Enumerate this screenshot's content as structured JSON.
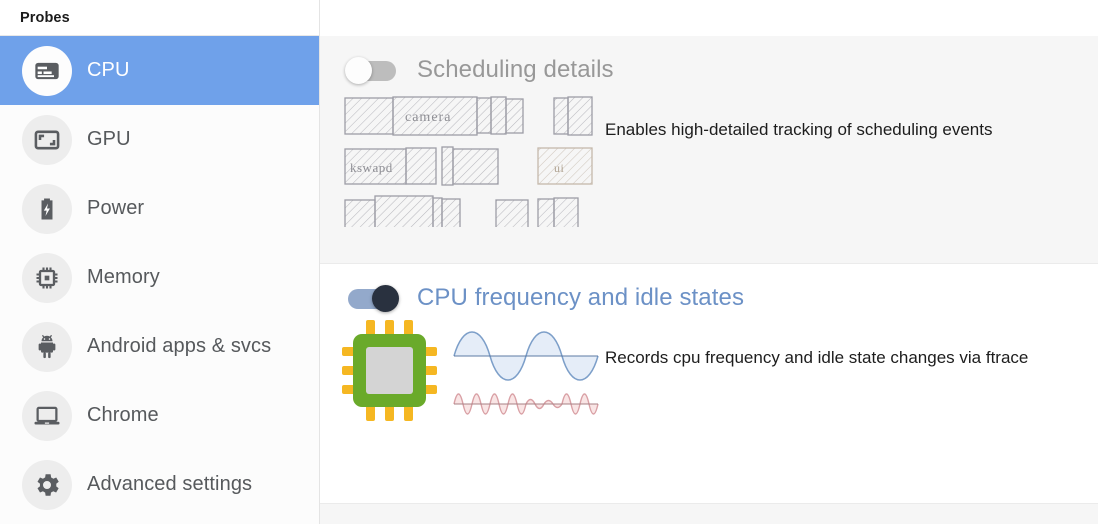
{
  "sidebar": {
    "title": "Probes",
    "items": [
      {
        "label": "CPU",
        "icon": "cpu-card-icon",
        "active": true
      },
      {
        "label": "GPU",
        "icon": "gpu-screen-icon",
        "active": false
      },
      {
        "label": "Power",
        "icon": "battery-bolt-icon",
        "active": false
      },
      {
        "label": "Memory",
        "icon": "memory-chip-icon",
        "active": false
      },
      {
        "label": "Android apps & svcs",
        "icon": "android-robot-icon",
        "active": false
      },
      {
        "label": "Chrome",
        "icon": "laptop-icon",
        "active": false
      },
      {
        "label": "Advanced settings",
        "icon": "gear-icon",
        "active": false
      }
    ]
  },
  "main": {
    "probes": [
      {
        "id": "scheduling-details",
        "title": "Scheduling details",
        "description": "Enables high-detailed tracking of scheduling events",
        "enabled": false,
        "toggle_state": "off",
        "art": "sketch-scheduling-slices",
        "art_labels": [
          "camera",
          "kswapd",
          "ui"
        ]
      },
      {
        "id": "cpu-frequency-and-idle-states",
        "title": "CPU frequency and idle states",
        "description": "Records cpu frequency and idle state changes via ftrace",
        "enabled": true,
        "toggle_state": "on",
        "art": "cpu-chip-and-waveforms"
      }
    ]
  },
  "colors": {
    "accent_blue": "#6fa1ea",
    "title_accent": "#6c91c6",
    "toggle_on_track": "#93a9cb",
    "toggle_on_knob": "#29313f",
    "toggle_off_track": "#bdbdbd",
    "section_gray": "#f6f6f6",
    "chip_green": "#6aaa2a",
    "chip_pin_orange": "#f5b722",
    "wave_blue": "#7d9fc9",
    "wave_pink": "#d9a0a5"
  }
}
